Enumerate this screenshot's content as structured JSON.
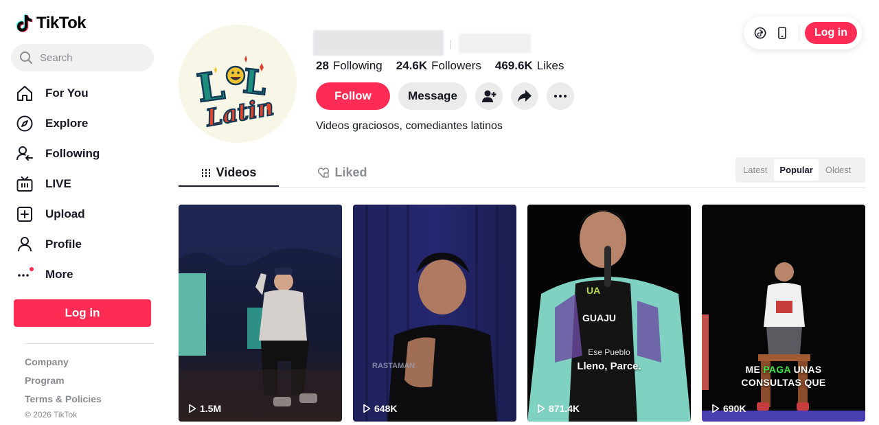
{
  "app": {
    "logo_text": "TikTok"
  },
  "search": {
    "placeholder": "Search"
  },
  "nav": {
    "items": [
      {
        "label": "For You",
        "icon": "home-icon"
      },
      {
        "label": "Explore",
        "icon": "compass-icon"
      },
      {
        "label": "Following",
        "icon": "following-icon"
      },
      {
        "label": "LIVE",
        "icon": "live-icon"
      },
      {
        "label": "Upload",
        "icon": "upload-icon"
      },
      {
        "label": "Profile",
        "icon": "profile-icon"
      },
      {
        "label": "More",
        "icon": "more-icon"
      }
    ]
  },
  "sidebar": {
    "login_label": "Log in",
    "footer_links": [
      "Company",
      "Program",
      "Terms & Policies"
    ],
    "copyright": "© 2026 TikTok"
  },
  "topbar": {
    "login_label": "Log in"
  },
  "profile": {
    "stats": {
      "following_count": "28",
      "following_label": "Following",
      "followers_count": "24.6K",
      "followers_label": "Followers",
      "likes_count": "469.6K",
      "likes_label": "Likes"
    },
    "follow_label": "Follow",
    "message_label": "Message",
    "bio": "Videos graciosos, comediantes latinos"
  },
  "tabs": {
    "videos": "Videos",
    "liked": "Liked"
  },
  "sort": {
    "options": [
      "Latest",
      "Popular",
      "Oldest"
    ],
    "selected": "Popular"
  },
  "videos": [
    {
      "views": "1.5M"
    },
    {
      "views": "648K",
      "overlay": "RASTAMAN"
    },
    {
      "views": "871.4K",
      "caption_small": "Ese Pueblo",
      "caption": "Lleno, Parce."
    },
    {
      "views": "690K",
      "caption_line1_a": "ME",
      "caption_line1_b": "PAGA",
      "caption_line1_c": "UNAS",
      "caption_line2": "CONSULTAS QUE"
    }
  ],
  "colors": {
    "accent": "#fe2c55",
    "text": "#161823",
    "muted": "#8a8b91"
  }
}
